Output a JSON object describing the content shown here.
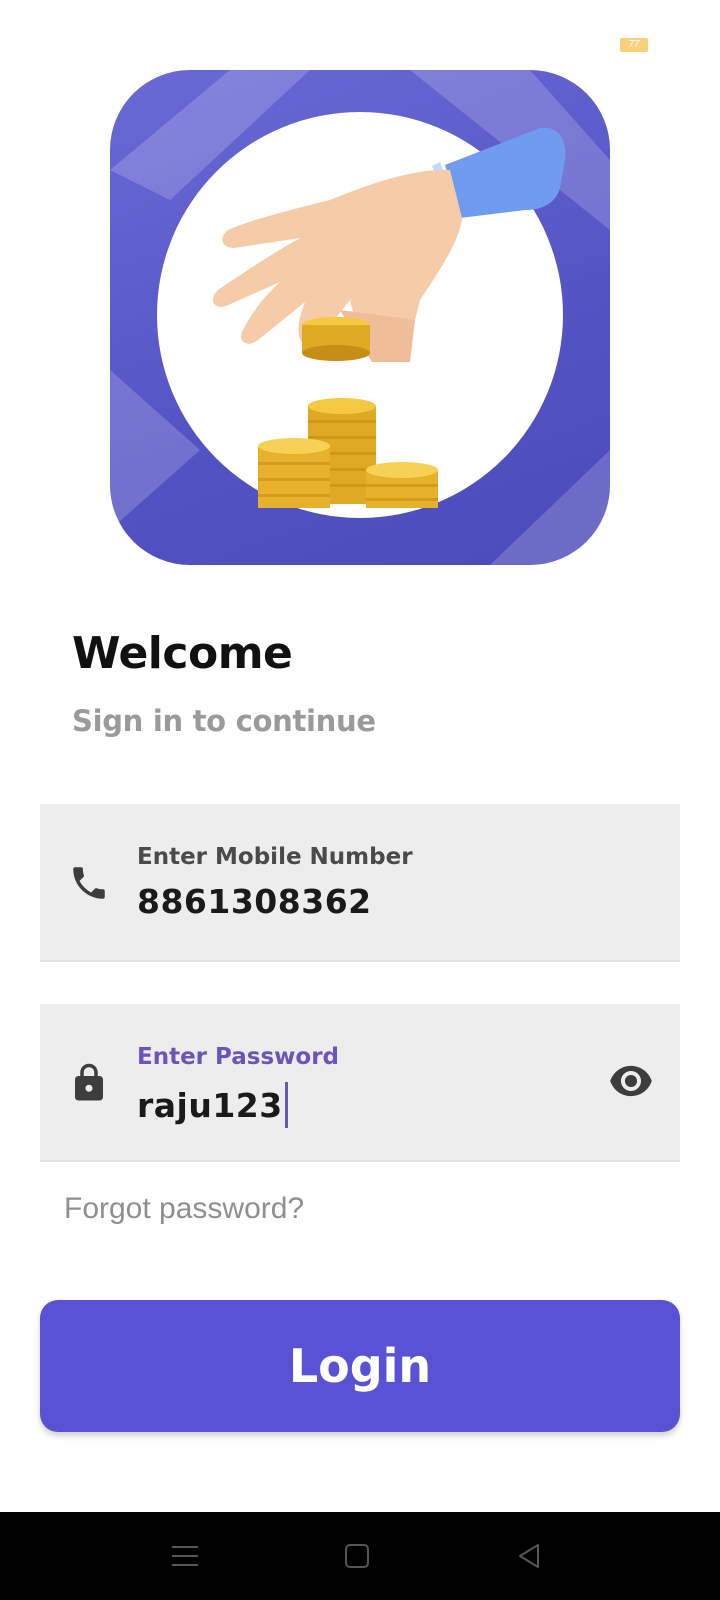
{
  "status_bar": {
    "battery_level": "77"
  },
  "hero": {
    "icon": "hand-with-coins-icon",
    "background_color": "#5a52d5"
  },
  "welcome": {
    "title": "Welcome",
    "subtitle": "Sign in to continue"
  },
  "form": {
    "mobile": {
      "label": "Enter Mobile Number",
      "value": "8861308362",
      "icon": "phone-icon"
    },
    "password": {
      "label": "Enter Password",
      "value": "raju123",
      "icon": "lock-icon",
      "toggle_icon": "eye-icon"
    },
    "forgot_label": "Forgot password?",
    "login_label": "Login"
  },
  "colors": {
    "accent": "#5a52d5",
    "field_bg": "#ededed",
    "label_active": "#6a55b8"
  },
  "navbar": {
    "icons": [
      "menu-icon",
      "home-square-icon",
      "back-triangle-icon"
    ]
  }
}
